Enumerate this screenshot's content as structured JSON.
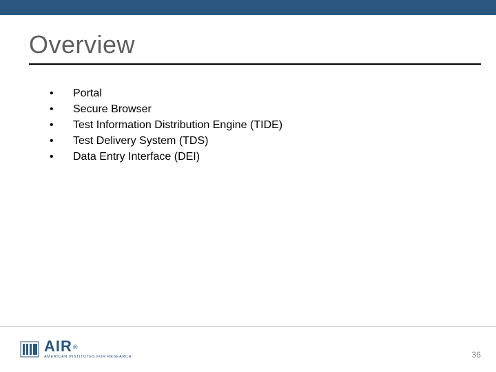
{
  "title": "Overview",
  "bullets": [
    "Portal",
    "Secure Browser",
    "Test Information Distribution Engine (TIDE)",
    "Test Delivery System (TDS)",
    "Data Entry Interface (DEI)"
  ],
  "footer": {
    "logo_text": "AIR",
    "logo_subtext": "AMERICAN INSTITUTES FOR RESEARCH",
    "registered": "®"
  },
  "page_number": "36",
  "colors": {
    "brand": "#2a567f"
  }
}
